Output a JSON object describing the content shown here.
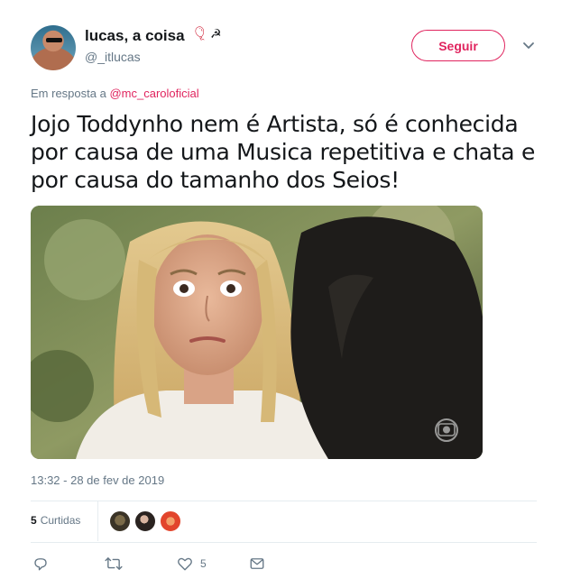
{
  "author": {
    "name": "lucas, a coisa",
    "handle": "@_itlucas",
    "name_emoji": [
      "balloon-icon",
      "hammer-sickle-icon"
    ]
  },
  "follow_button": {
    "label": "Seguir"
  },
  "reply_context": {
    "prefix": "Em resposta a",
    "mention": "@mc_caroloficial"
  },
  "tweet": {
    "lines": [
      "Jojo Toddynho nem é Artista, só é conhecida",
      "por causa de uma Musica repetitiva e chata e",
      "por causa do tamanho dos Seios!"
    ]
  },
  "media": {
    "watermark_icon": "globo-logo"
  },
  "timestamp": "13:32 - 28 de fev de 2019",
  "stats": {
    "likes_count": "5",
    "likes_label": "Curtidas"
  },
  "actions": {
    "reply_count": "",
    "retweet_count": "",
    "like_count": "5",
    "message_count": ""
  },
  "colors": {
    "accent": "#e0245e",
    "secondary_text": "#657786",
    "divider": "#e6ecf0"
  }
}
